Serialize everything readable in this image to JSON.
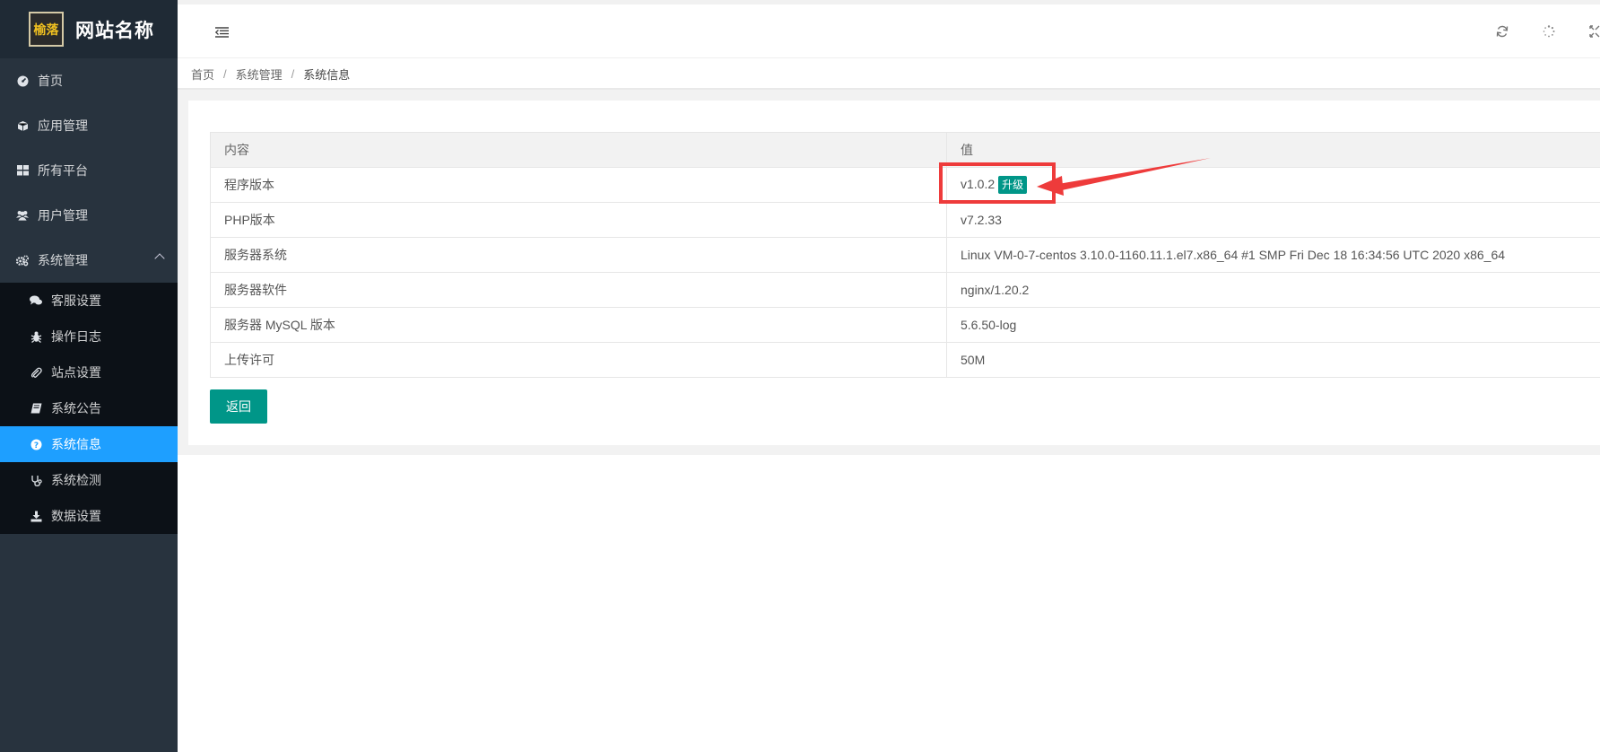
{
  "site": {
    "name": "网站名称",
    "logo_text": "榆落"
  },
  "sidebar": {
    "items": [
      {
        "label": "首页",
        "icon": "dashboard-icon"
      },
      {
        "label": "应用管理",
        "icon": "cube-icon"
      },
      {
        "label": "所有平台",
        "icon": "grid-icon"
      },
      {
        "label": "用户管理",
        "icon": "users-icon"
      },
      {
        "label": "系统管理",
        "icon": "gears-icon",
        "expanded": true
      }
    ],
    "sub_items": [
      {
        "label": "客服设置",
        "icon": "comments-icon"
      },
      {
        "label": "操作日志",
        "icon": "bug-icon"
      },
      {
        "label": "站点设置",
        "icon": "paperclip-icon"
      },
      {
        "label": "系统公告",
        "icon": "book-icon"
      },
      {
        "label": "系统信息",
        "icon": "question-circle-icon",
        "active": true
      },
      {
        "label": "系统检测",
        "icon": "stethoscope-icon"
      },
      {
        "label": "数据设置",
        "icon": "download-icon"
      }
    ]
  },
  "breadcrumb": [
    "首页",
    "系统管理",
    "系统信息"
  ],
  "table": {
    "headers": [
      "内容",
      "值"
    ],
    "rows": [
      {
        "label": "程序版本",
        "value": "v1.0.2",
        "badge": "升级"
      },
      {
        "label": "PHP版本",
        "value": "v7.2.33"
      },
      {
        "label": "服务器系统",
        "value": "Linux VM-0-7-centos 3.10.0-1160.11.1.el7.x86_64 #1 SMP Fri Dec 18 16:34:56 UTC 2020 x86_64"
      },
      {
        "label": "服务器软件",
        "value": "nginx/1.20.2"
      },
      {
        "label": "服务器 MySQL 版本",
        "value": "5.6.50-log"
      },
      {
        "label": "上传许可",
        "value": "50M"
      }
    ]
  },
  "buttons": {
    "back": "返回"
  },
  "colors": {
    "sidebar": "#28333e",
    "active": "#1e9fff",
    "primary": "#009688",
    "annotation": "#ee3b3b"
  }
}
